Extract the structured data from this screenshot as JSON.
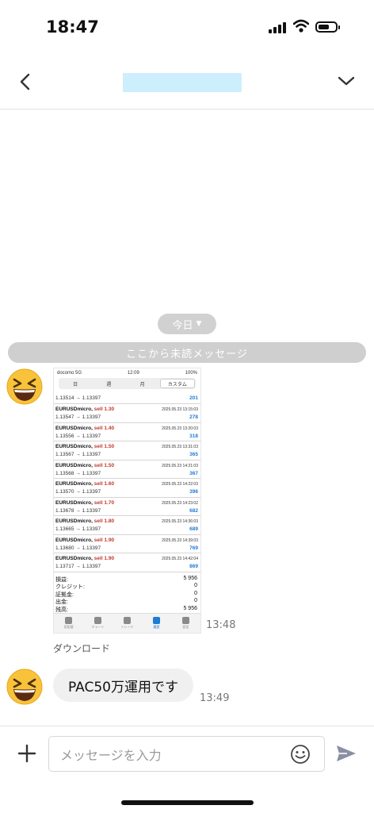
{
  "status": {
    "time": "18:47"
  },
  "chat": {
    "date_label": "今日",
    "unread_label": "ここから未読メッセージ",
    "download_label": "ダウンロード",
    "image_time": "13:48",
    "text_message": "PAC50万運用です",
    "text_time": "13:49"
  },
  "input": {
    "placeholder": "メッセージを入力"
  },
  "shared_image": {
    "status": {
      "carrier": "docomo 5G",
      "time": "12:09",
      "battery": "100%"
    },
    "tabs": [
      "日",
      "週",
      "月",
      "カスタム"
    ],
    "first_row": {
      "prices": "1.13514 → 1.13397",
      "profit": "201"
    },
    "trades": [
      {
        "symbol": "EURUSDmicro,",
        "side": "sell 1.30",
        "datetime": "2025.05.23 13:15:03",
        "prices": "1.13547 → 1.13397",
        "profit": "278"
      },
      {
        "symbol": "EURUSDmicro,",
        "side": "sell 1.40",
        "datetime": "2025.05.23 13:20:03",
        "prices": "1.13556 → 1.13397",
        "profit": "318"
      },
      {
        "symbol": "EURUSDmicro,",
        "side": "sell 1.50",
        "datetime": "2025.05.23 13:31:03",
        "prices": "1.13567 → 1.13397",
        "profit": "365"
      },
      {
        "symbol": "EURUSDmicro,",
        "side": "sell 1.50",
        "datetime": "2025.05.23 14:21:03",
        "prices": "1.13568 → 1.13397",
        "profit": "367"
      },
      {
        "symbol": "EURUSDmicro,",
        "side": "sell 1.60",
        "datetime": "2025.05.23 14:22:03",
        "prices": "1.13570 → 1.13397",
        "profit": "396"
      },
      {
        "symbol": "EURUSDmicro,",
        "side": "sell 1.70",
        "datetime": "2025.05.23 14:23:02",
        "prices": "1.13678 → 1.13397",
        "profit": "682"
      },
      {
        "symbol": "EURUSDmicro,",
        "side": "sell 1.80",
        "datetime": "2025.05.23 14:36:03",
        "prices": "1.13665 → 1.13397",
        "profit": "689"
      },
      {
        "symbol": "EURUSDmicro,",
        "side": "sell 1.90",
        "datetime": "2025.05.23 14:39:03",
        "prices": "1.13680 → 1.13397",
        "profit": "769"
      },
      {
        "symbol": "EURUSDmicro,",
        "side": "sell 1.90",
        "datetime": "2025.05.23 14:42:04",
        "prices": "1.13717 → 1.13397",
        "profit": "869"
      }
    ],
    "summary": [
      {
        "label": "損益:",
        "value": "5 956"
      },
      {
        "label": "クレジット:",
        "value": "0"
      },
      {
        "label": "証拠金:",
        "value": "0"
      },
      {
        "label": "出金:",
        "value": "0"
      },
      {
        "label": "残高:",
        "value": "5 956"
      }
    ],
    "tabbar": [
      "気配値",
      "チャート",
      "トレード",
      "履歴",
      "設定"
    ]
  },
  "colors": {
    "accent": "#1e7bd6",
    "sell": "#c0392b",
    "title_placeholder": "#cdeefc"
  }
}
